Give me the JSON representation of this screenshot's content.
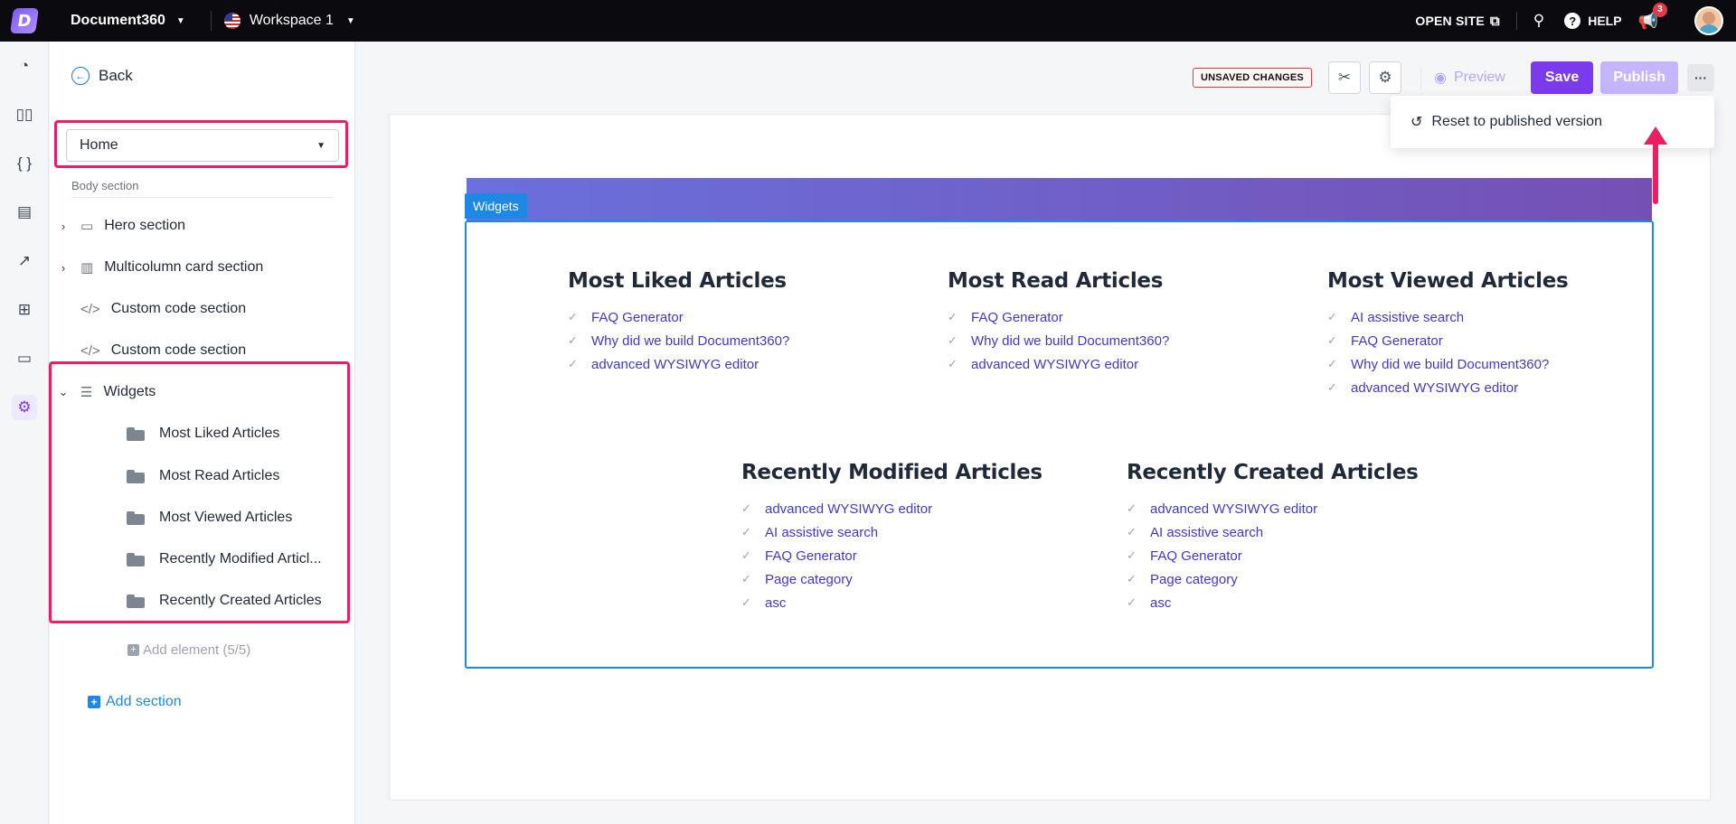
{
  "topbar": {
    "project": "Document360",
    "workspace": "Workspace 1",
    "open_site": "OPEN SITE",
    "help": "HELP",
    "notif_count": "3"
  },
  "rail": [
    "dashboard-icon",
    "book-icon",
    "code-icon",
    "comments-icon",
    "analytics-icon",
    "apps-icon",
    "drive-icon",
    "settings-icon"
  ],
  "panel": {
    "back": "Back",
    "page_select": "Home",
    "body_label": "Body section",
    "sections": [
      {
        "label": "Hero section",
        "icon": "layout-icon"
      },
      {
        "label": "Multicolumn card section",
        "icon": "columns-icon"
      },
      {
        "label": "Custom code section",
        "icon": "code-icon"
      },
      {
        "label": "Custom code section",
        "icon": "code-icon"
      },
      {
        "label": "Widgets",
        "icon": "list-icon"
      }
    ],
    "widgets": [
      "Most Liked Articles",
      "Most Read Articles",
      "Most Viewed Articles",
      "Recently Modified Articl...",
      "Recently Created Articles"
    ],
    "add_element": "Add element (5/5)",
    "add_section": "Add section"
  },
  "actions": {
    "unsaved": "UNSAVED CHANGES",
    "preview": "Preview",
    "save": "Save",
    "publish": "Publish",
    "more": "···"
  },
  "dropdown": {
    "reset": "Reset to published version"
  },
  "canvas": {
    "tag": "Widgets",
    "columns": [
      {
        "title": "Most Liked Articles",
        "items": [
          "FAQ Generator",
          "Why did we build Document360?",
          "advanced WYSIWYG editor"
        ]
      },
      {
        "title": "Most Read Articles",
        "items": [
          "FAQ Generator",
          "Why did we build Document360?",
          "advanced WYSIWYG editor"
        ]
      },
      {
        "title": "Most Viewed Articles",
        "items": [
          "AI assistive search",
          "FAQ Generator",
          "Why did we build Document360?",
          "advanced WYSIWYG editor"
        ]
      },
      {
        "title": "Recently Modified Articles",
        "items": [
          "advanced WYSIWYG editor",
          "AI assistive search",
          "FAQ Generator",
          "Page category",
          "asc"
        ]
      },
      {
        "title": "Recently Created Articles",
        "items": [
          "advanced WYSIWYG editor",
          "AI assistive search",
          "FAQ Generator",
          "Page category",
          "asc"
        ]
      }
    ]
  },
  "colors": {
    "accent": "#7c3aed",
    "highlight": "#e91e63",
    "link": "#4338ca",
    "widget_border": "#1e88e5"
  }
}
